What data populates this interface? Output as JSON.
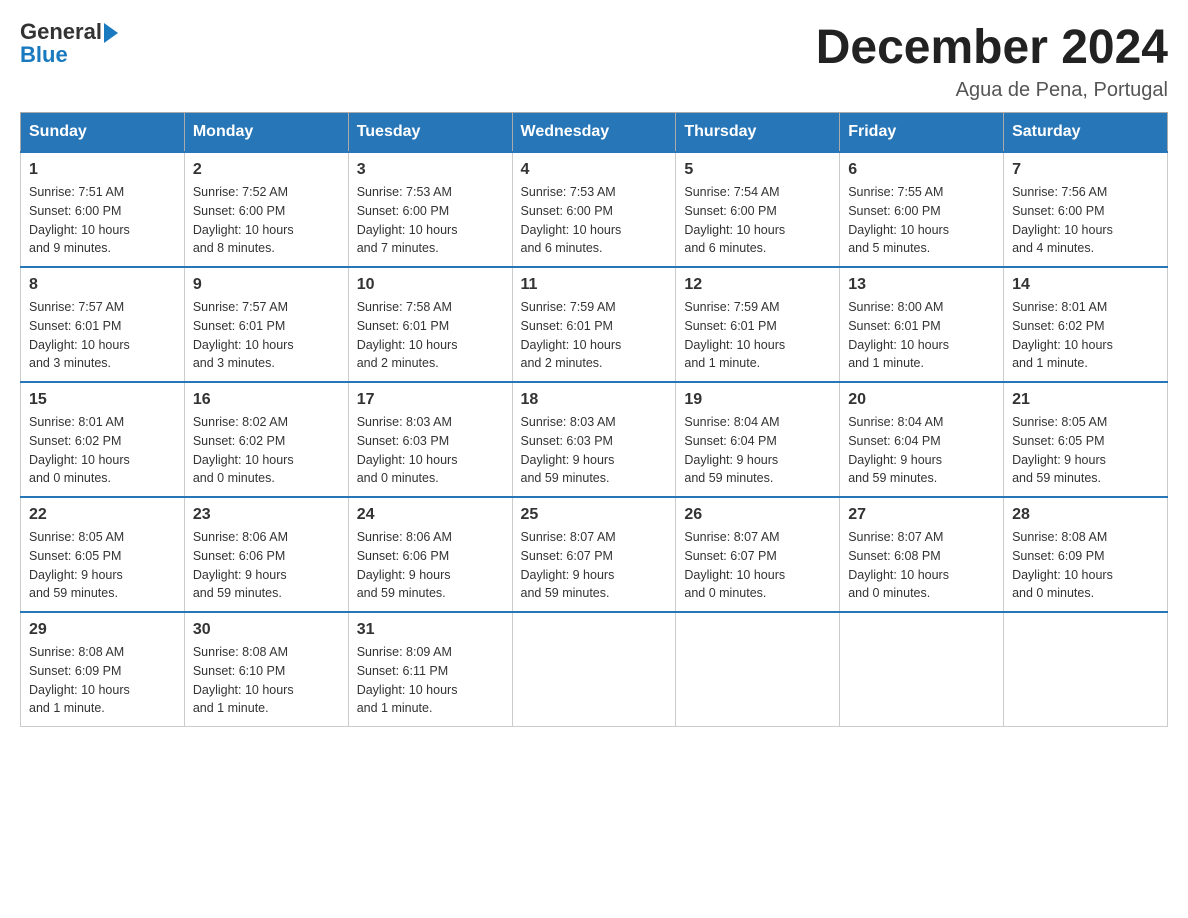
{
  "header": {
    "logo_line1": "General",
    "logo_line2": "Blue",
    "month_title": "December 2024",
    "subtitle": "Agua de Pena, Portugal"
  },
  "days_of_week": [
    "Sunday",
    "Monday",
    "Tuesday",
    "Wednesday",
    "Thursday",
    "Friday",
    "Saturday"
  ],
  "weeks": [
    [
      {
        "day": "1",
        "info": "Sunrise: 7:51 AM\nSunset: 6:00 PM\nDaylight: 10 hours\nand 9 minutes."
      },
      {
        "day": "2",
        "info": "Sunrise: 7:52 AM\nSunset: 6:00 PM\nDaylight: 10 hours\nand 8 minutes."
      },
      {
        "day": "3",
        "info": "Sunrise: 7:53 AM\nSunset: 6:00 PM\nDaylight: 10 hours\nand 7 minutes."
      },
      {
        "day": "4",
        "info": "Sunrise: 7:53 AM\nSunset: 6:00 PM\nDaylight: 10 hours\nand 6 minutes."
      },
      {
        "day": "5",
        "info": "Sunrise: 7:54 AM\nSunset: 6:00 PM\nDaylight: 10 hours\nand 6 minutes."
      },
      {
        "day": "6",
        "info": "Sunrise: 7:55 AM\nSunset: 6:00 PM\nDaylight: 10 hours\nand 5 minutes."
      },
      {
        "day": "7",
        "info": "Sunrise: 7:56 AM\nSunset: 6:00 PM\nDaylight: 10 hours\nand 4 minutes."
      }
    ],
    [
      {
        "day": "8",
        "info": "Sunrise: 7:57 AM\nSunset: 6:01 PM\nDaylight: 10 hours\nand 3 minutes."
      },
      {
        "day": "9",
        "info": "Sunrise: 7:57 AM\nSunset: 6:01 PM\nDaylight: 10 hours\nand 3 minutes."
      },
      {
        "day": "10",
        "info": "Sunrise: 7:58 AM\nSunset: 6:01 PM\nDaylight: 10 hours\nand 2 minutes."
      },
      {
        "day": "11",
        "info": "Sunrise: 7:59 AM\nSunset: 6:01 PM\nDaylight: 10 hours\nand 2 minutes."
      },
      {
        "day": "12",
        "info": "Sunrise: 7:59 AM\nSunset: 6:01 PM\nDaylight: 10 hours\nand 1 minute."
      },
      {
        "day": "13",
        "info": "Sunrise: 8:00 AM\nSunset: 6:01 PM\nDaylight: 10 hours\nand 1 minute."
      },
      {
        "day": "14",
        "info": "Sunrise: 8:01 AM\nSunset: 6:02 PM\nDaylight: 10 hours\nand 1 minute."
      }
    ],
    [
      {
        "day": "15",
        "info": "Sunrise: 8:01 AM\nSunset: 6:02 PM\nDaylight: 10 hours\nand 0 minutes."
      },
      {
        "day": "16",
        "info": "Sunrise: 8:02 AM\nSunset: 6:02 PM\nDaylight: 10 hours\nand 0 minutes."
      },
      {
        "day": "17",
        "info": "Sunrise: 8:03 AM\nSunset: 6:03 PM\nDaylight: 10 hours\nand 0 minutes."
      },
      {
        "day": "18",
        "info": "Sunrise: 8:03 AM\nSunset: 6:03 PM\nDaylight: 9 hours\nand 59 minutes."
      },
      {
        "day": "19",
        "info": "Sunrise: 8:04 AM\nSunset: 6:04 PM\nDaylight: 9 hours\nand 59 minutes."
      },
      {
        "day": "20",
        "info": "Sunrise: 8:04 AM\nSunset: 6:04 PM\nDaylight: 9 hours\nand 59 minutes."
      },
      {
        "day": "21",
        "info": "Sunrise: 8:05 AM\nSunset: 6:05 PM\nDaylight: 9 hours\nand 59 minutes."
      }
    ],
    [
      {
        "day": "22",
        "info": "Sunrise: 8:05 AM\nSunset: 6:05 PM\nDaylight: 9 hours\nand 59 minutes."
      },
      {
        "day": "23",
        "info": "Sunrise: 8:06 AM\nSunset: 6:06 PM\nDaylight: 9 hours\nand 59 minutes."
      },
      {
        "day": "24",
        "info": "Sunrise: 8:06 AM\nSunset: 6:06 PM\nDaylight: 9 hours\nand 59 minutes."
      },
      {
        "day": "25",
        "info": "Sunrise: 8:07 AM\nSunset: 6:07 PM\nDaylight: 9 hours\nand 59 minutes."
      },
      {
        "day": "26",
        "info": "Sunrise: 8:07 AM\nSunset: 6:07 PM\nDaylight: 10 hours\nand 0 minutes."
      },
      {
        "day": "27",
        "info": "Sunrise: 8:07 AM\nSunset: 6:08 PM\nDaylight: 10 hours\nand 0 minutes."
      },
      {
        "day": "28",
        "info": "Sunrise: 8:08 AM\nSunset: 6:09 PM\nDaylight: 10 hours\nand 0 minutes."
      }
    ],
    [
      {
        "day": "29",
        "info": "Sunrise: 8:08 AM\nSunset: 6:09 PM\nDaylight: 10 hours\nand 1 minute."
      },
      {
        "day": "30",
        "info": "Sunrise: 8:08 AM\nSunset: 6:10 PM\nDaylight: 10 hours\nand 1 minute."
      },
      {
        "day": "31",
        "info": "Sunrise: 8:09 AM\nSunset: 6:11 PM\nDaylight: 10 hours\nand 1 minute."
      },
      {
        "day": "",
        "info": ""
      },
      {
        "day": "",
        "info": ""
      },
      {
        "day": "",
        "info": ""
      },
      {
        "day": "",
        "info": ""
      }
    ]
  ]
}
